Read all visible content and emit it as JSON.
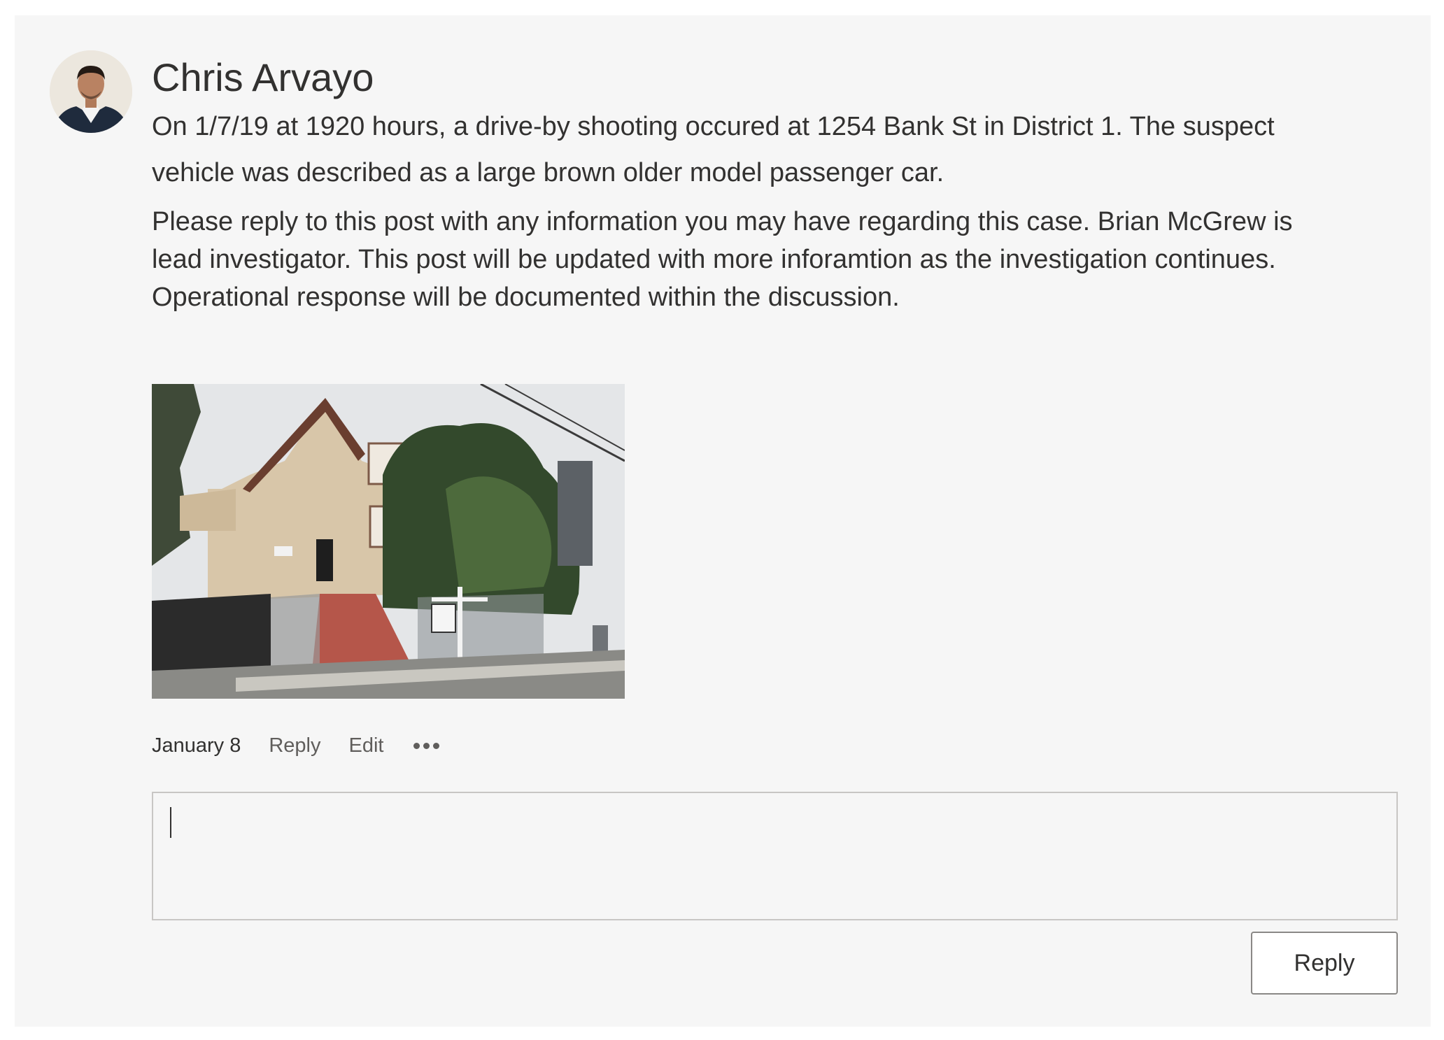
{
  "post": {
    "author": "Chris Arvayo",
    "paragraph1_line1": "On 1/7/19 at 1920 hours, a drive-by shooting occured at 1254 Bank St in District 1.  The suspect",
    "paragraph1_line2": "vehicle was described as a large brown older model passenger car.",
    "paragraph2_line1": "Please reply to this post with any information you may have regarding this case.  Brian McGrew is",
    "paragraph2_line2": "lead investigator.  This post will be updated with more inforamtion as the investigation continues.",
    "paragraph2_line3": "Operational response will be documented within the discussion."
  },
  "actions": {
    "date": "January 8",
    "reply_label": "Reply",
    "edit_label": "Edit",
    "more_icon": "ellipsis-icon"
  },
  "reply_box": {
    "value": "",
    "placeholder": ""
  },
  "reply_button": {
    "label": "Reply"
  },
  "colors": {
    "card_background": "#f6f6f6",
    "text_primary": "#323130",
    "text_secondary": "#605e5c",
    "border": "#c8c6c4"
  }
}
